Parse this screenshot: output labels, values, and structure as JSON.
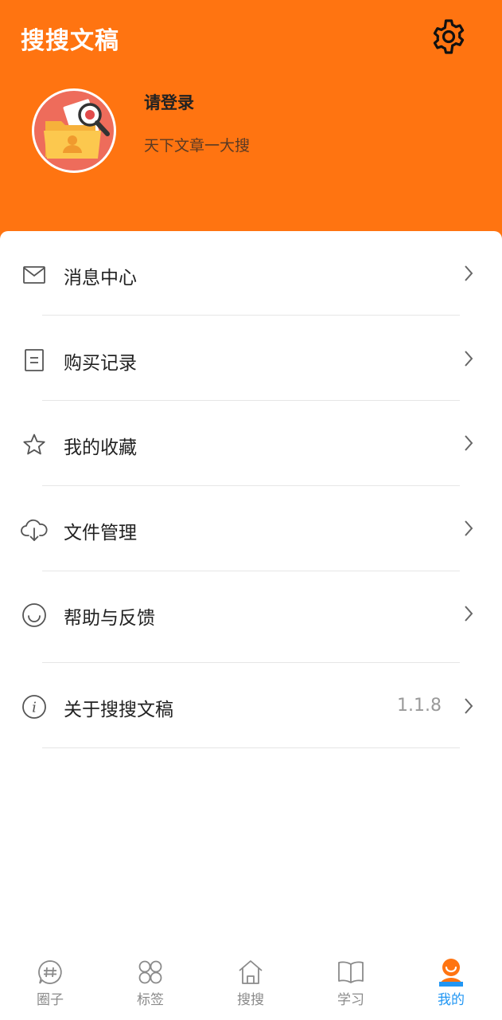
{
  "header": {
    "app_title": "搜搜文稿",
    "login_text": "请登录",
    "slogan": "天下文章一大搜",
    "settings_icon": "gear-icon",
    "accent_color": "#FF7411"
  },
  "menu": {
    "items": [
      {
        "label": "消息中心",
        "icon": "mail-icon"
      },
      {
        "label": "购买记录",
        "icon": "receipt-icon"
      },
      {
        "label": "我的收藏",
        "icon": "star-icon"
      },
      {
        "label": "文件管理",
        "icon": "cloud-download-icon"
      },
      {
        "label": "帮助与反馈",
        "icon": "smile-icon"
      },
      {
        "label": "关于搜搜文稿",
        "icon": "info-icon",
        "value": "1.1.8"
      }
    ]
  },
  "bottom_nav": {
    "active_color": "#2196F3",
    "items": [
      {
        "label": "圈子",
        "icon": "hashtag-chat-icon"
      },
      {
        "label": "标签",
        "icon": "grid-petals-icon"
      },
      {
        "label": "搜搜",
        "icon": "home-icon"
      },
      {
        "label": "学习",
        "icon": "book-icon"
      },
      {
        "label": "我的",
        "icon": "user-icon",
        "active": true
      }
    ]
  }
}
